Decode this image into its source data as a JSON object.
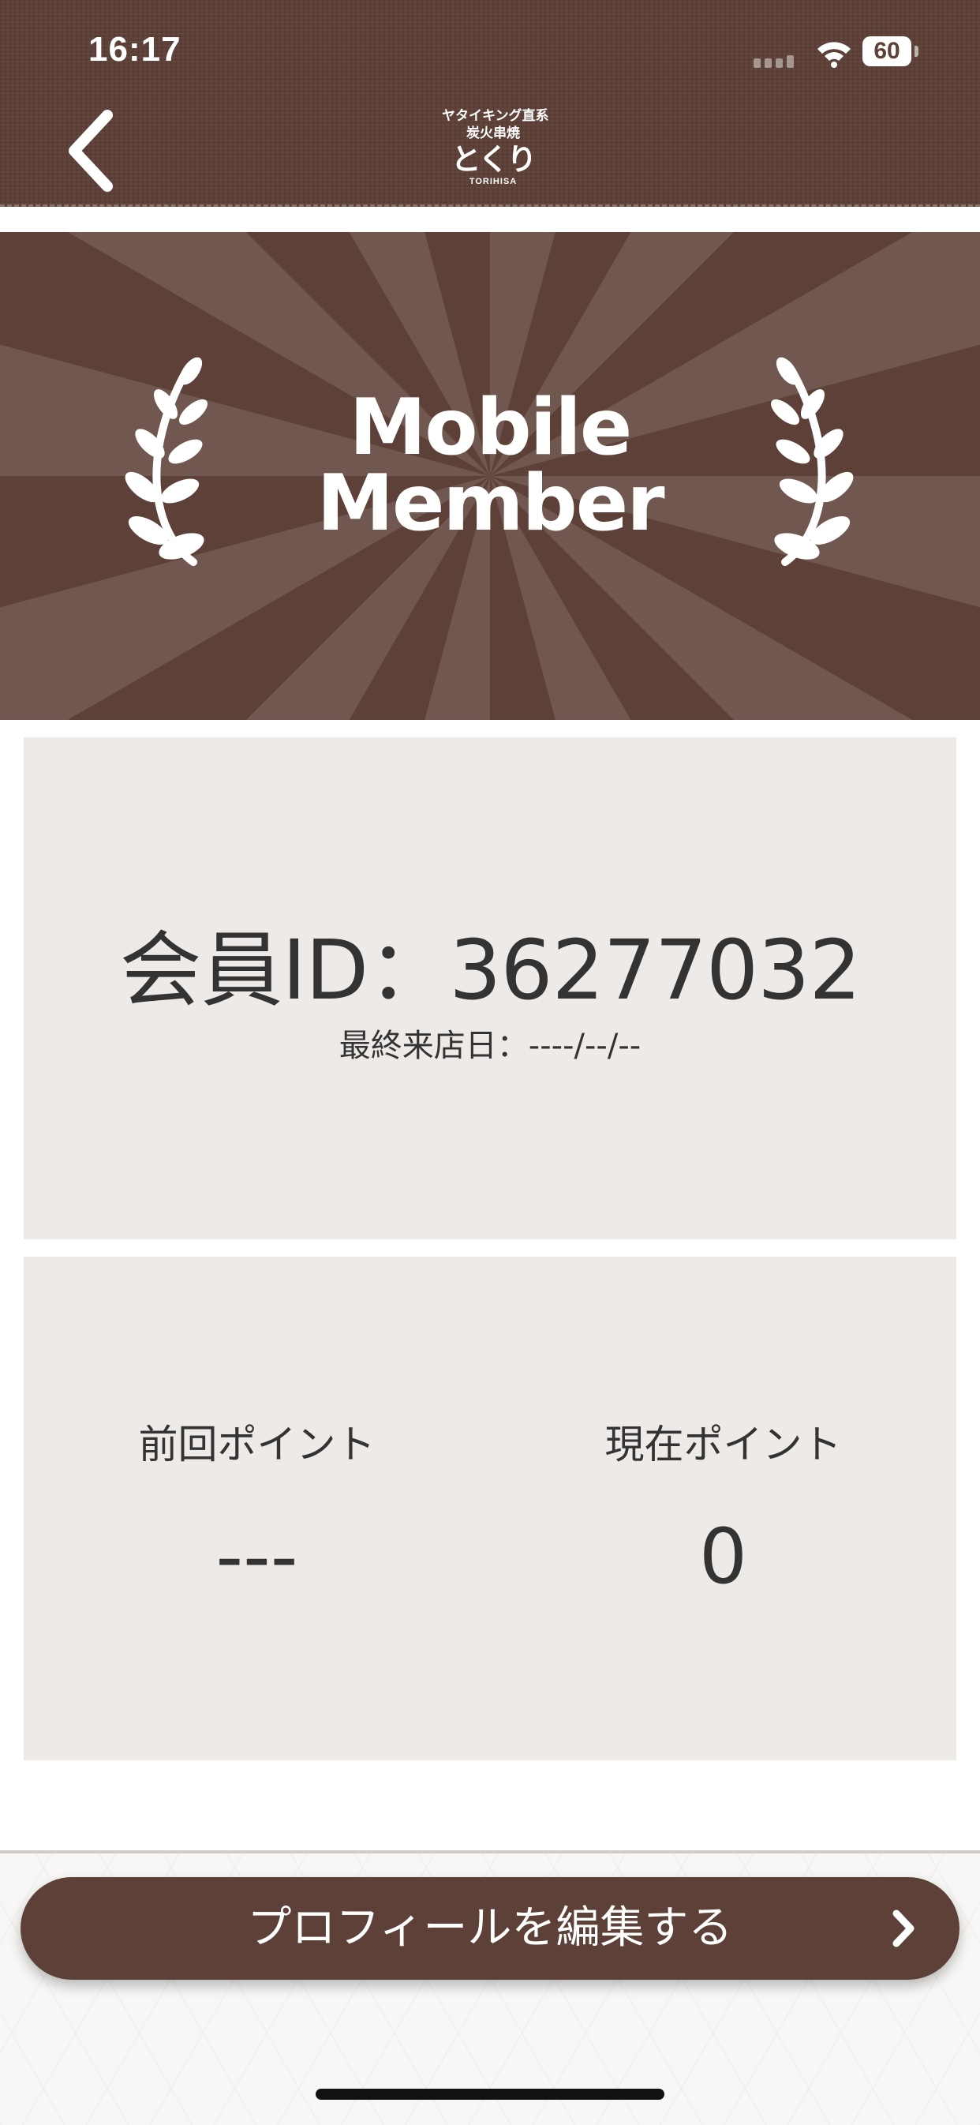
{
  "status_bar": {
    "time": "16:17",
    "battery": "60"
  },
  "header": {
    "back_icon": "chevron-left-icon",
    "logo": {
      "top_text": "ヤタイキング直系",
      "sub_text": "炭火串焼",
      "main_text": "とくり",
      "romaji": "TORIHISA"
    }
  },
  "banner": {
    "title_line1": "Mobile",
    "title_line2": "Member",
    "icons": [
      "laurel-left-icon",
      "laurel-right-icon"
    ]
  },
  "member": {
    "id_text": "会員ID：36277032",
    "last_visit_text": "最終来店日：----/--/--"
  },
  "points": {
    "previous_label": "前回ポイント",
    "previous_value": "---",
    "current_label": "現在ポイント",
    "current_value": "0"
  },
  "footer": {
    "edit_profile_label": "プロフィールを編集する",
    "edit_icon": "chevron-right-icon"
  },
  "colors": {
    "brand_brown": "#5d4037",
    "card_bg": "#edeae8",
    "text": "#333333"
  }
}
